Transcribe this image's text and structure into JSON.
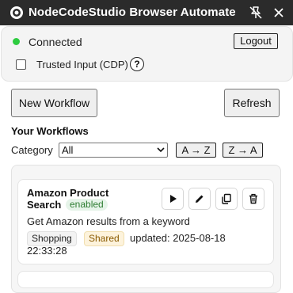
{
  "window": {
    "title": "NodeCodeStudio Browser Automate",
    "app_icon": "target-icon",
    "pin_icon": "pin-off-icon",
    "close_icon": "close-icon",
    "bg_color": "#2b2b2b"
  },
  "connection": {
    "status": "Connected",
    "status_color": "#2ecc40",
    "logout_label": "Logout",
    "trusted_input_label": "Trusted Input (CDP)",
    "trusted_input_checked": false,
    "help_label": "?"
  },
  "actions": {
    "new_workflow_label": "New Workflow",
    "refresh_label": "Refresh"
  },
  "workflows_section": {
    "title": "Your Workflows",
    "category_label": "Category",
    "category_selected": "All",
    "sort_az_label": "A → Z",
    "sort_za_label": "Z → A"
  },
  "workflows": [
    {
      "name": "Amazon Product Search",
      "status": "enabled",
      "description": "Get Amazon results from a keyword",
      "category_tag": "Shopping",
      "shared_tag": "Shared",
      "updated": "updated: 2025-08-18 22:33:28",
      "action_icons": [
        "play-icon",
        "pencil-icon",
        "copy-icon",
        "trash-icon"
      ]
    }
  ]
}
